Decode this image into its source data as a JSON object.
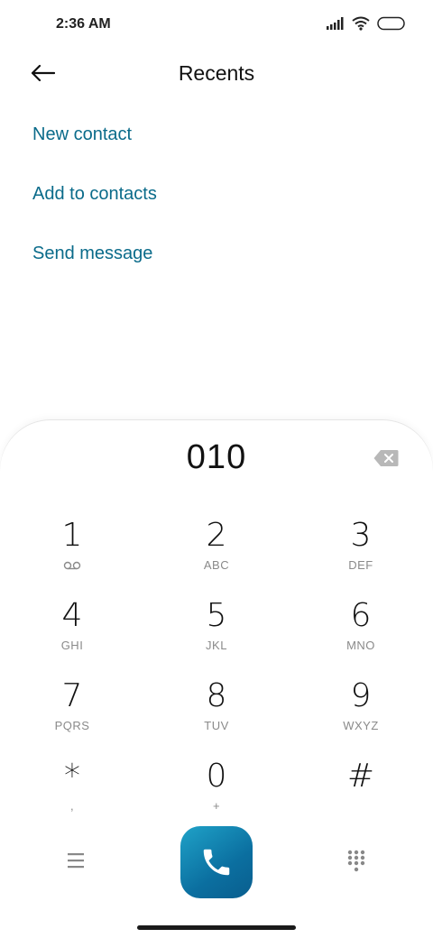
{
  "status_bar": {
    "time": "2:36 AM",
    "icons": [
      "signal-icon",
      "wifi-icon",
      "battery-icon"
    ]
  },
  "header": {
    "title": "Recents",
    "back_icon": "back-arrow-icon"
  },
  "actions": [
    {
      "label": "New contact"
    },
    {
      "label": "Add to contacts"
    },
    {
      "label": "Send message"
    }
  ],
  "dialer": {
    "number": "010",
    "backspace_icon": "backspace-icon",
    "keys": [
      {
        "digit": "1",
        "letters": "",
        "icon": "voicemail-icon"
      },
      {
        "digit": "2",
        "letters": "ABC"
      },
      {
        "digit": "3",
        "letters": "DEF"
      },
      {
        "digit": "4",
        "letters": "GHI"
      },
      {
        "digit": "5",
        "letters": "JKL"
      },
      {
        "digit": "6",
        "letters": "MNO"
      },
      {
        "digit": "7",
        "letters": "PQRS"
      },
      {
        "digit": "8",
        "letters": "TUV"
      },
      {
        "digit": "9",
        "letters": "WXYZ"
      },
      {
        "digit": "*",
        "letters": ","
      },
      {
        "digit": "0",
        "letters": "+"
      },
      {
        "digit": "#",
        "letters": ""
      }
    ],
    "bottom": {
      "menu_icon": "menu-icon",
      "call_icon": "phone-icon",
      "keypad_icon": "keypad-icon"
    },
    "colors": {
      "accent": "#0a6b8a",
      "call_button": "#0b6fa0"
    }
  }
}
